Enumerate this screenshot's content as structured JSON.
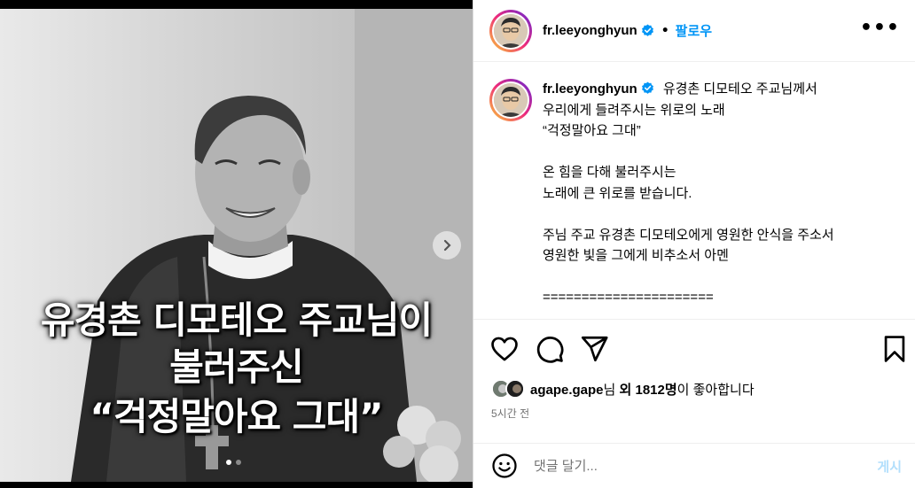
{
  "media": {
    "caption_lines": [
      "유경촌 디모테오 주교님이",
      "불러주신",
      "“걱정말아요 그대”"
    ],
    "next_icon": "chevron-right-icon",
    "carousel": {
      "total": 2,
      "active": 1
    }
  },
  "header": {
    "username": "fr.leeyonghyun",
    "separator": "•",
    "follow_label": "팔로우",
    "more_icon": "more-horizontal-icon",
    "more_glyph": "•••"
  },
  "post_caption": {
    "username": "fr.leeyonghyun",
    "lines": [
      "유경촌 디모테오 주교님께서",
      "우리에게 들려주시는 위로의 노래",
      "“걱정말아요 그대”",
      "",
      "온 힘을 다해 불러주시는",
      "노래에 큰 위로를 받습니다.",
      "",
      "주님 주교 유경촌 디모테오에게 영원한 안식을 주소서",
      "영원한 빛을 그에게 비추소서 아멘",
      "",
      "======================"
    ]
  },
  "actions": {
    "like_icon": "heart-icon",
    "comment_icon": "comment-icon",
    "share_icon": "send-icon",
    "save_icon": "bookmark-icon"
  },
  "likes": {
    "user": "agape.gape",
    "suffix_1": "님",
    "others": "외 1812명",
    "suffix_2": "이 좋아합니다"
  },
  "timestamp": "5시간 전",
  "comment": {
    "emoji_icon": "emoji-icon",
    "placeholder": "댓글 달기...",
    "post_label": "게시"
  },
  "colors": {
    "accent": "#0095f6",
    "post_disabled": "#b2dffc",
    "muted": "#737373"
  }
}
